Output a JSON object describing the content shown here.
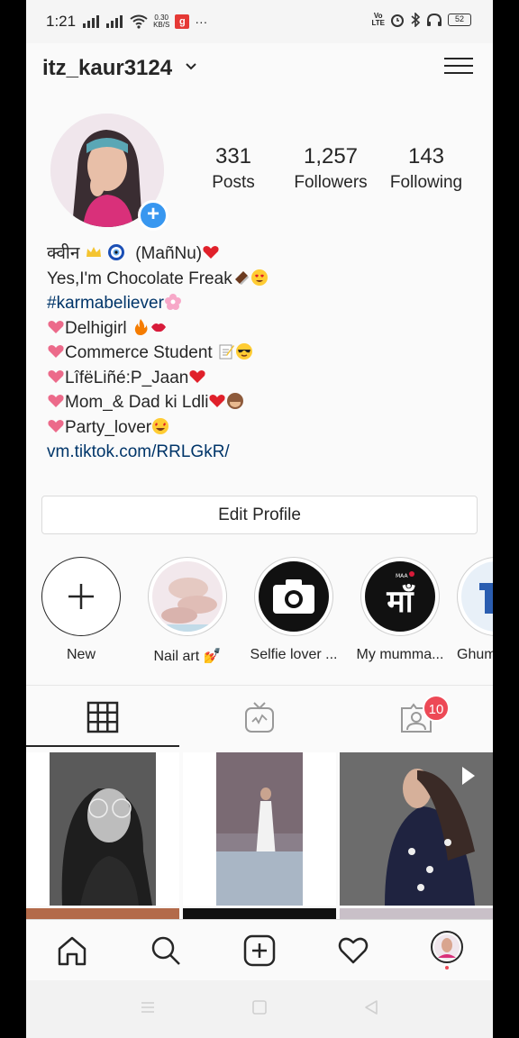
{
  "status_bar": {
    "time": "1:21",
    "speed_value": "0.30",
    "speed_unit": "KB/S",
    "app_badge": "g",
    "more": "···",
    "volte_top": "Vo",
    "volte_bottom": "LTE",
    "battery": "52"
  },
  "header": {
    "username": "itz_kaur3124"
  },
  "profile": {
    "stats": [
      {
        "value": "331",
        "label": "Posts"
      },
      {
        "value": "1,257",
        "label": "Followers"
      },
      {
        "value": "143",
        "label": "Following"
      }
    ],
    "bio": {
      "line1": "क्वीन",
      "line1b": "(MañNu)",
      "line2": "Yes,I'm Chocolate Freak",
      "hashtag": "#karmabeliever",
      "line4": "Delhigirl",
      "line5": "Commerce Student",
      "line6": "LîfëLiñé:P_Jaan",
      "line7": "Mom_& Dad ki Ldli",
      "line8": "Party_lover",
      "link": "vm.tiktok.com/RRLGkR/"
    },
    "edit_button": "Edit Profile"
  },
  "highlights": [
    {
      "label": "New"
    },
    {
      "label": "Nail art 💅"
    },
    {
      "label": "Selfie lover ..."
    },
    {
      "label": "My mumma..."
    },
    {
      "label": "Ghum"
    }
  ],
  "highlight_art": {
    "maa_small": "MAA",
    "maa_big": "माँ"
  },
  "tabs": {
    "notification_count": "10"
  },
  "colors": {
    "accent_blue": "#3897f0",
    "link_blue": "#003569",
    "badge_red": "#ed4956",
    "text": "#262626"
  },
  "icons": [
    "home-icon",
    "search-icon",
    "add-post-icon",
    "heart-icon",
    "profile-avatar",
    "grid-icon",
    "igtv-icon",
    "tagged-icon",
    "menu-icon"
  ]
}
